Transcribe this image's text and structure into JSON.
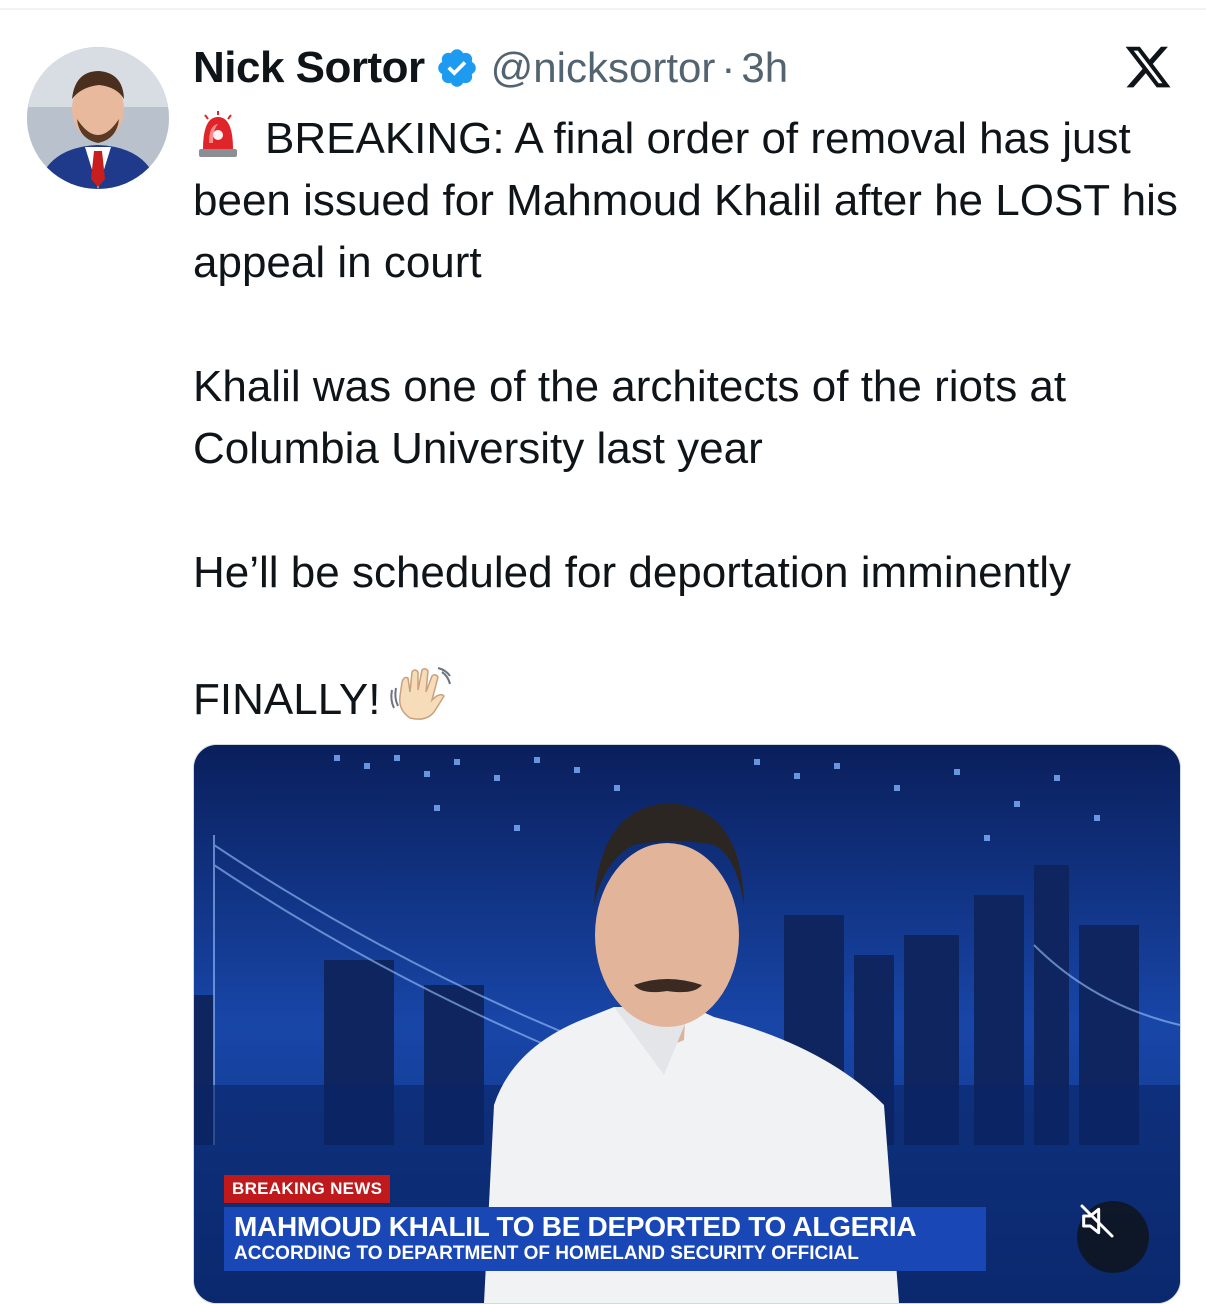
{
  "tweet": {
    "author_name": "Nick Sortor",
    "handle": "@nicksortor",
    "separator": "·",
    "timestamp": "3h",
    "paragraphs": {
      "p1": "BREAKING: A final order of removal has just been issued for Mahmoud Khalil after he LOST his appeal in court",
      "p2": "Khalil was one of the architects of the riots at Columbia University last year",
      "p3": "He’ll be scheduled for deportation imminently",
      "p4": "FINALLY!"
    },
    "emoji": {
      "first": "police-car-light",
      "last": "waving-hand"
    }
  },
  "media": {
    "lower_third": {
      "tag": "BREAKING NEWS",
      "headline": "MAHMOUD KHALIL TO BE DEPORTED TO ALGERIA",
      "subline": "ACCORDING TO DEPARTMENT OF HOMELAND SECURITY OFFICIAL"
    },
    "mute_icon": "speaker-muted-icon"
  },
  "colors": {
    "text": "#0f1419",
    "secondary_text": "#536471",
    "verified_blue": "#1d9bf0",
    "breaking_red": "#c0191c",
    "banner_blue": "#1a47b6"
  }
}
